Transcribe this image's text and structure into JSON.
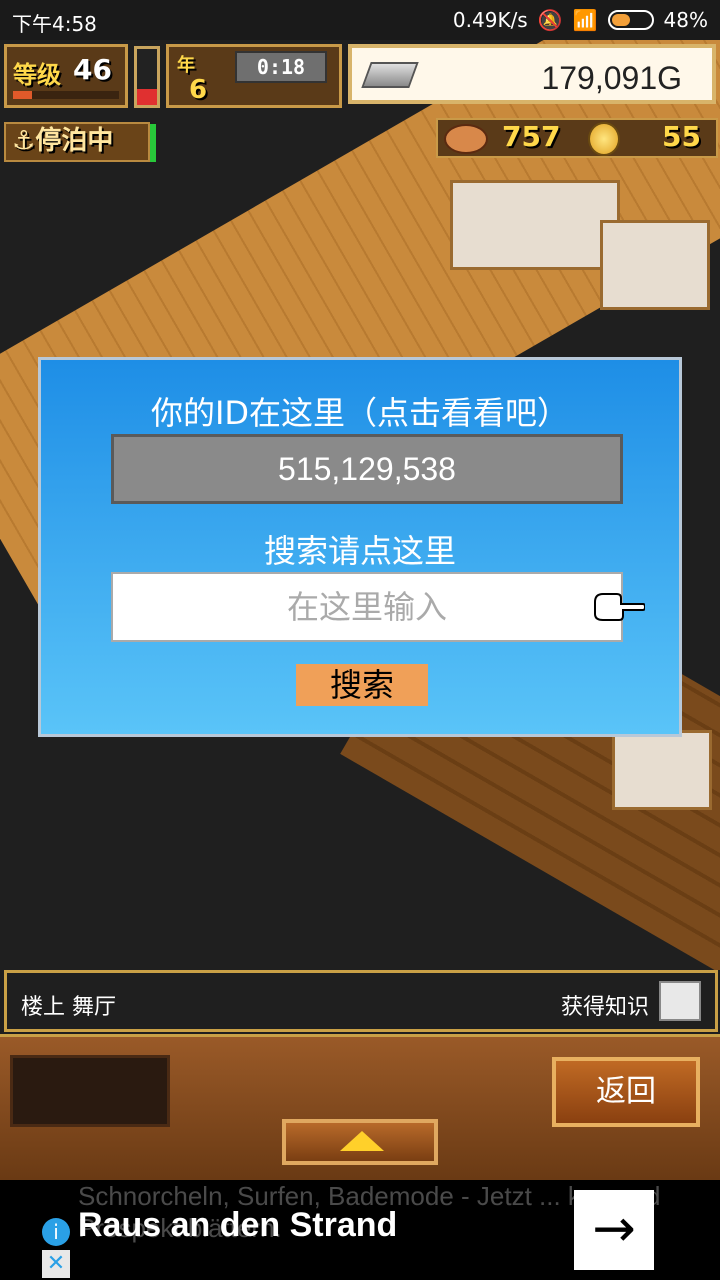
{
  "status_bar": {
    "time": "下午4:58",
    "net_speed": "0.49K/s",
    "battery": "48%",
    "battery_level": 0.48
  },
  "hud": {
    "level_label": "等级",
    "level_value": "46",
    "year_label": "年",
    "year_value": "6",
    "clock": "0:18",
    "gold": "179,091G",
    "anchor_status": "停泊中",
    "resource_1": "757",
    "resource_2": "55"
  },
  "dialog": {
    "title": "你的ID在这里（点击看看吧）",
    "player_id": "515,129,538",
    "search_hint": "搜索请点这里",
    "search_placeholder": "在这里输入",
    "search_button": "搜索"
  },
  "info_bar": {
    "location": "楼上 舞厅",
    "gain_knowledge": "获得知识"
  },
  "panel": {
    "back_button": "返回"
  },
  "ad": {
    "ghost_text": "Schnorcheln, Surfen, Bademode - Jetzt ... ken und Prospekt blättern.",
    "headline": "Raus an den Strand",
    "arrow": "→"
  }
}
